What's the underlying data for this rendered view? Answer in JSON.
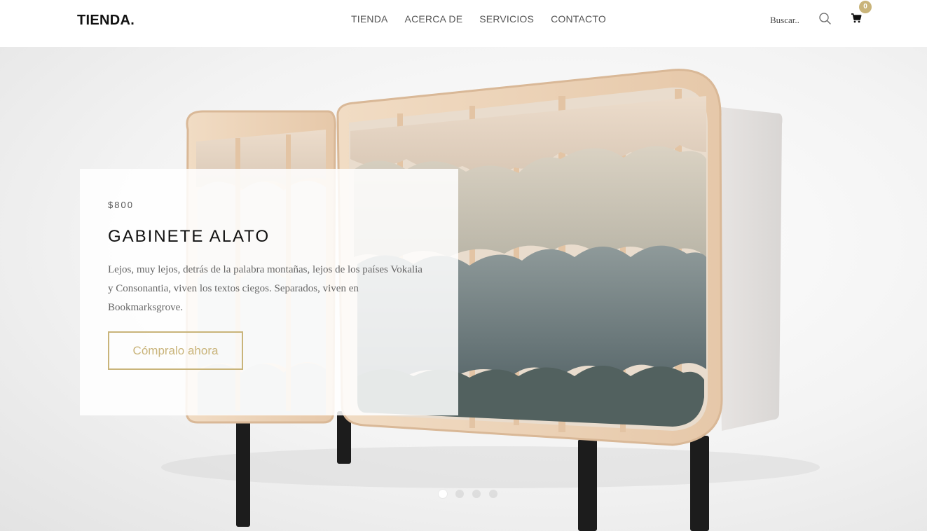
{
  "header": {
    "logo": "TIENDA.",
    "nav": [
      "TIENDA",
      "ACERCA DE",
      "SERVICIOS",
      "CONTACTO"
    ],
    "search": {
      "placeholder": "Buscar.."
    },
    "cart": {
      "count": "0"
    }
  },
  "hero": {
    "price": "$800",
    "title": "GABINETE ALATO",
    "description": "Lejos, muy lejos, detrás de la palabra montañas, lejos de los países Vokalia y Consonantia, viven los textos ciegos. Separados, viven en Bookmarksgrove.",
    "button_label": "Cómpralo ahora",
    "slides_total": 4,
    "slide_active": 1
  },
  "colors": {
    "accent": "#c9b47a",
    "text_dark": "#111111",
    "text_muted": "#666666"
  },
  "icons": {
    "search": "search-icon",
    "cart": "cart-icon"
  }
}
